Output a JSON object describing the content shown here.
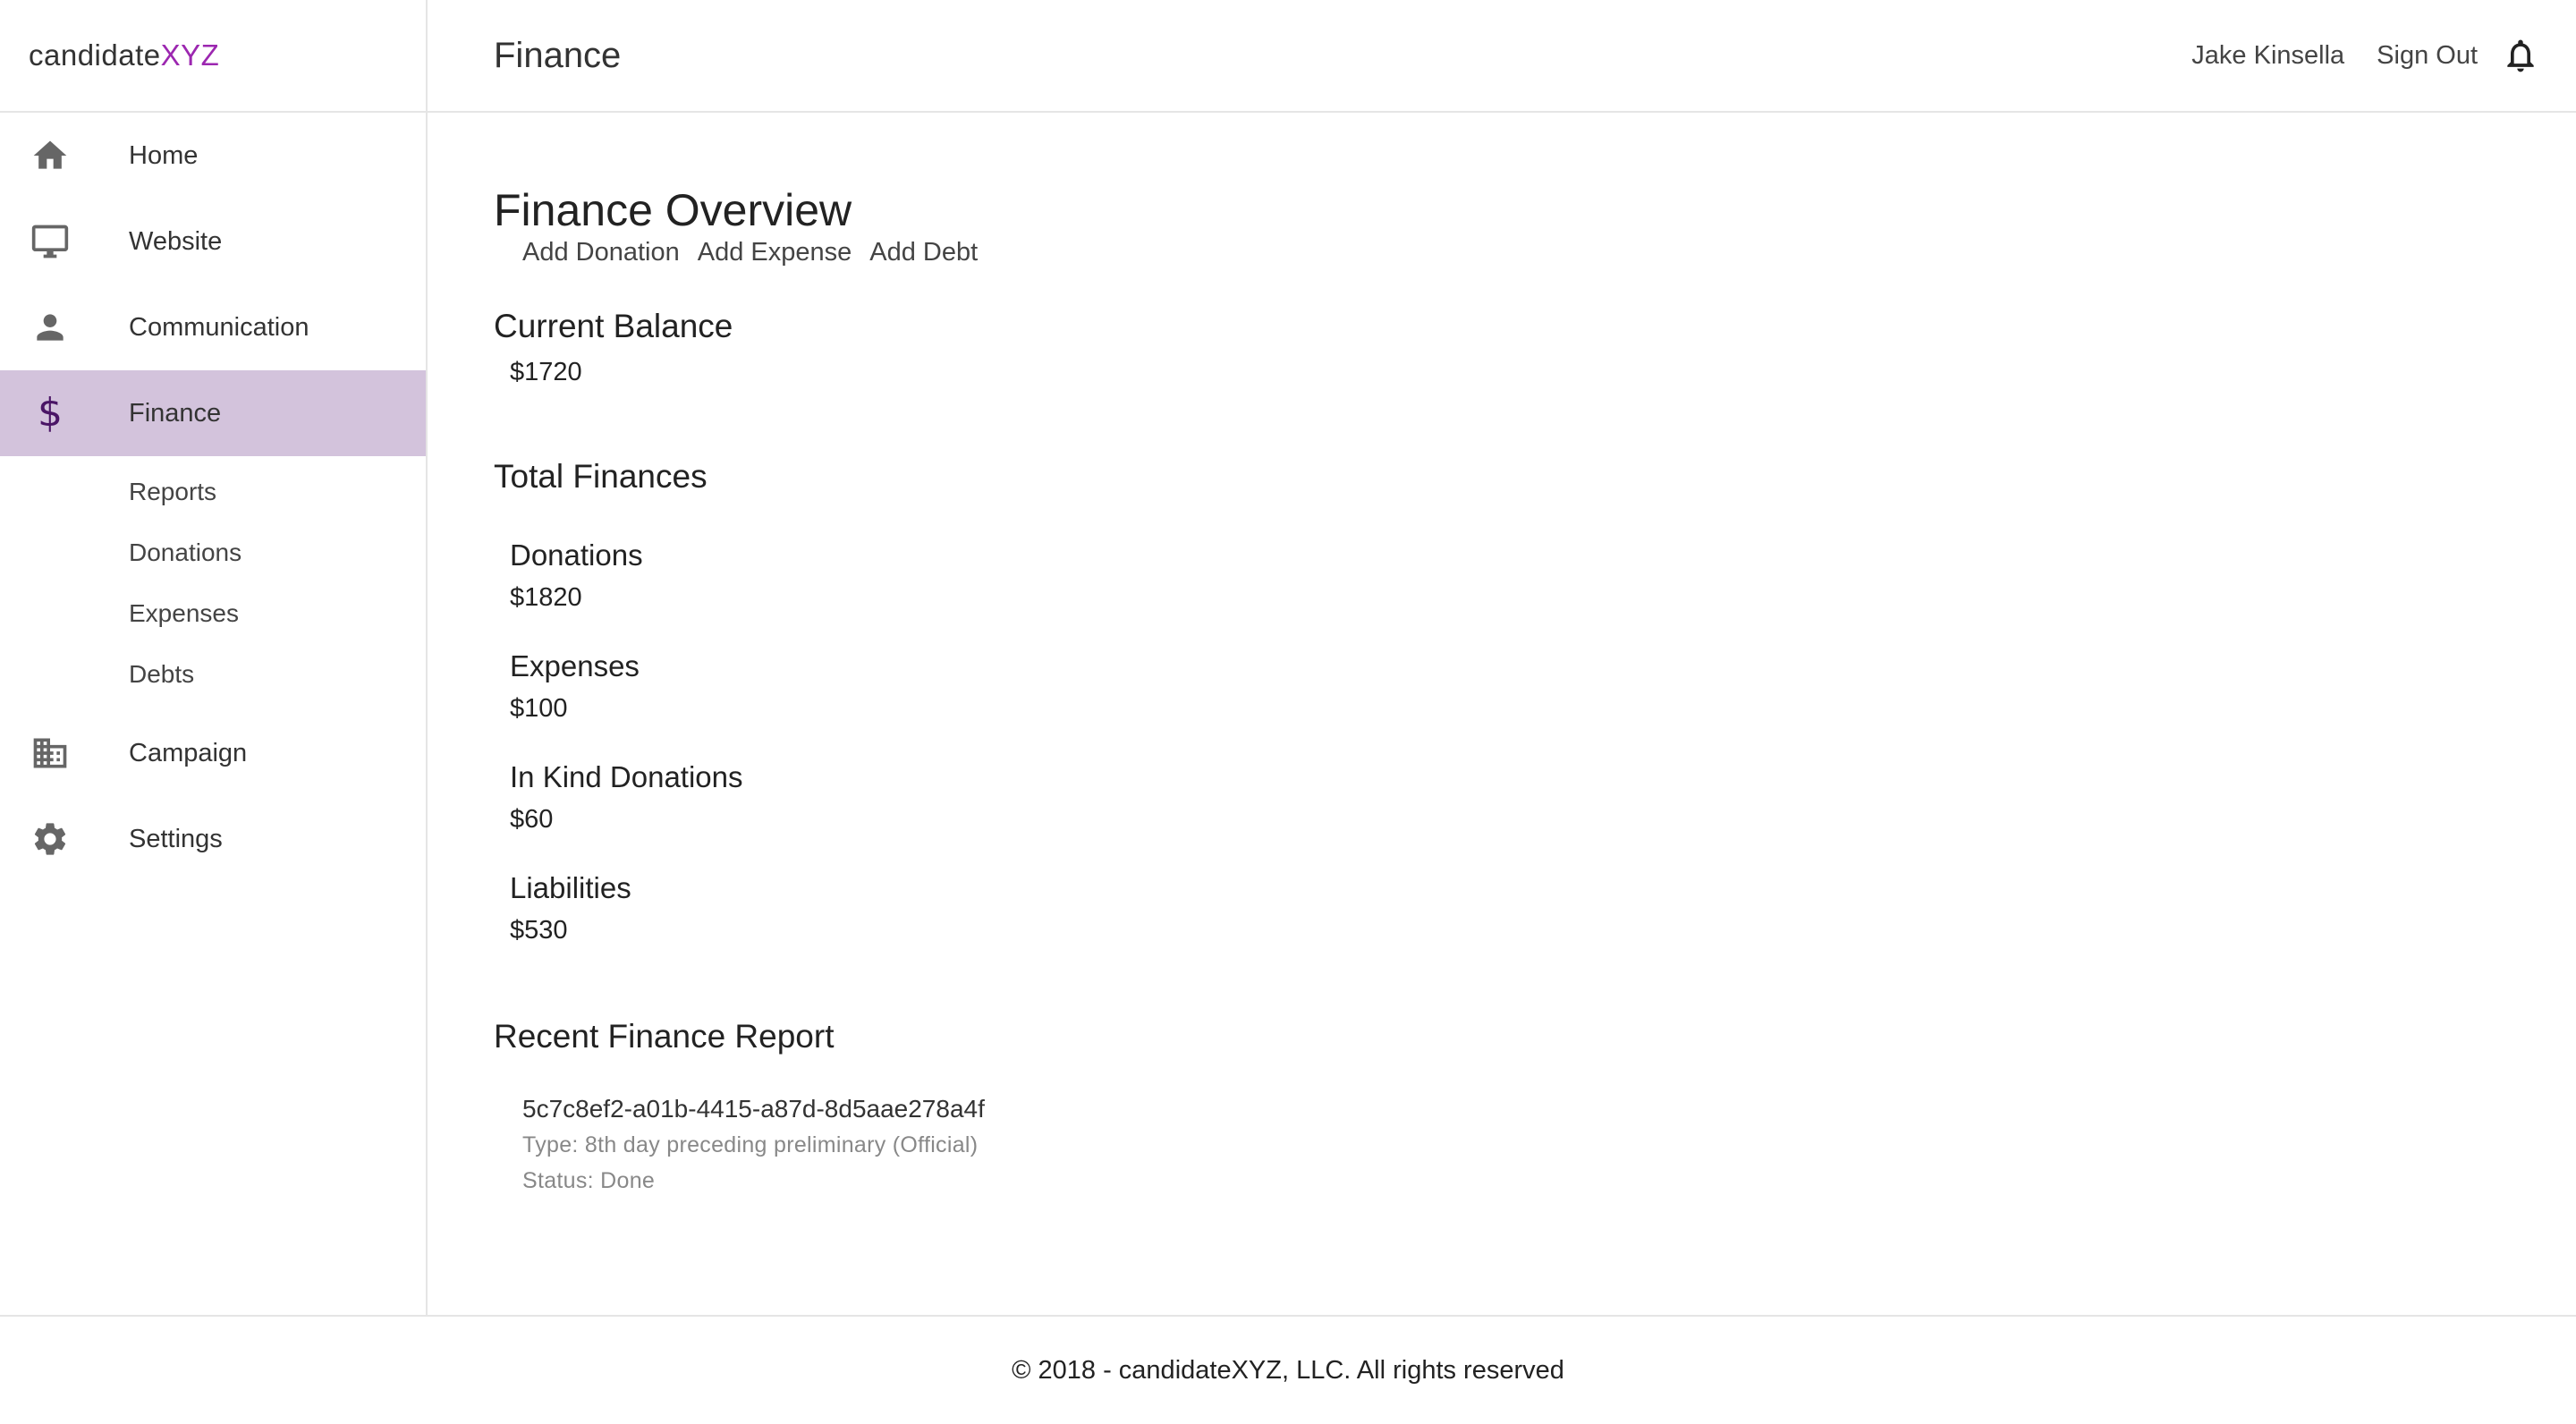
{
  "brand": {
    "name_prefix": "candidate",
    "name_accent": "XYZ"
  },
  "sidebar": {
    "items": [
      {
        "label": "Home",
        "icon": "home-icon"
      },
      {
        "label": "Website",
        "icon": "monitor-icon"
      },
      {
        "label": "Communication",
        "icon": "person-icon"
      },
      {
        "label": "Finance",
        "icon": "dollar-icon",
        "active": true
      },
      {
        "label": "Campaign",
        "icon": "building-icon"
      },
      {
        "label": "Settings",
        "icon": "gear-icon"
      }
    ],
    "finance_subitems": [
      "Reports",
      "Donations",
      "Expenses",
      "Debts"
    ],
    "finance_icon_glyph": "$"
  },
  "header": {
    "title": "Finance",
    "user_name": "Jake Kinsella",
    "sign_out": "Sign Out",
    "bell_icon": "bell-icon"
  },
  "main": {
    "title": "Finance Overview",
    "actions": [
      "Add Donation",
      "Add Expense",
      "Add Debt"
    ],
    "current_balance": {
      "label": "Current Balance",
      "value": "$1720"
    },
    "total_finances": {
      "label": "Total Finances",
      "items": [
        {
          "label": "Donations",
          "value": "$1820"
        },
        {
          "label": "Expenses",
          "value": "$100"
        },
        {
          "label": "In Kind Donations",
          "value": "$60"
        },
        {
          "label": "Liabilities",
          "value": "$530"
        }
      ]
    },
    "recent_report": {
      "label": "Recent Finance Report",
      "id": "5c7c8ef2-a01b-4415-a87d-8d5aae278a4f",
      "type": "Type: 8th day preceding preliminary (Official)",
      "status": "Status: Done"
    }
  },
  "footer": {
    "text": "© 2018 - candidateXYZ, LLC. All rights reserved"
  },
  "colors": {
    "accent": "#9c27b0",
    "active_bg": "#d3c3dc",
    "active_icon": "#4a1566"
  }
}
